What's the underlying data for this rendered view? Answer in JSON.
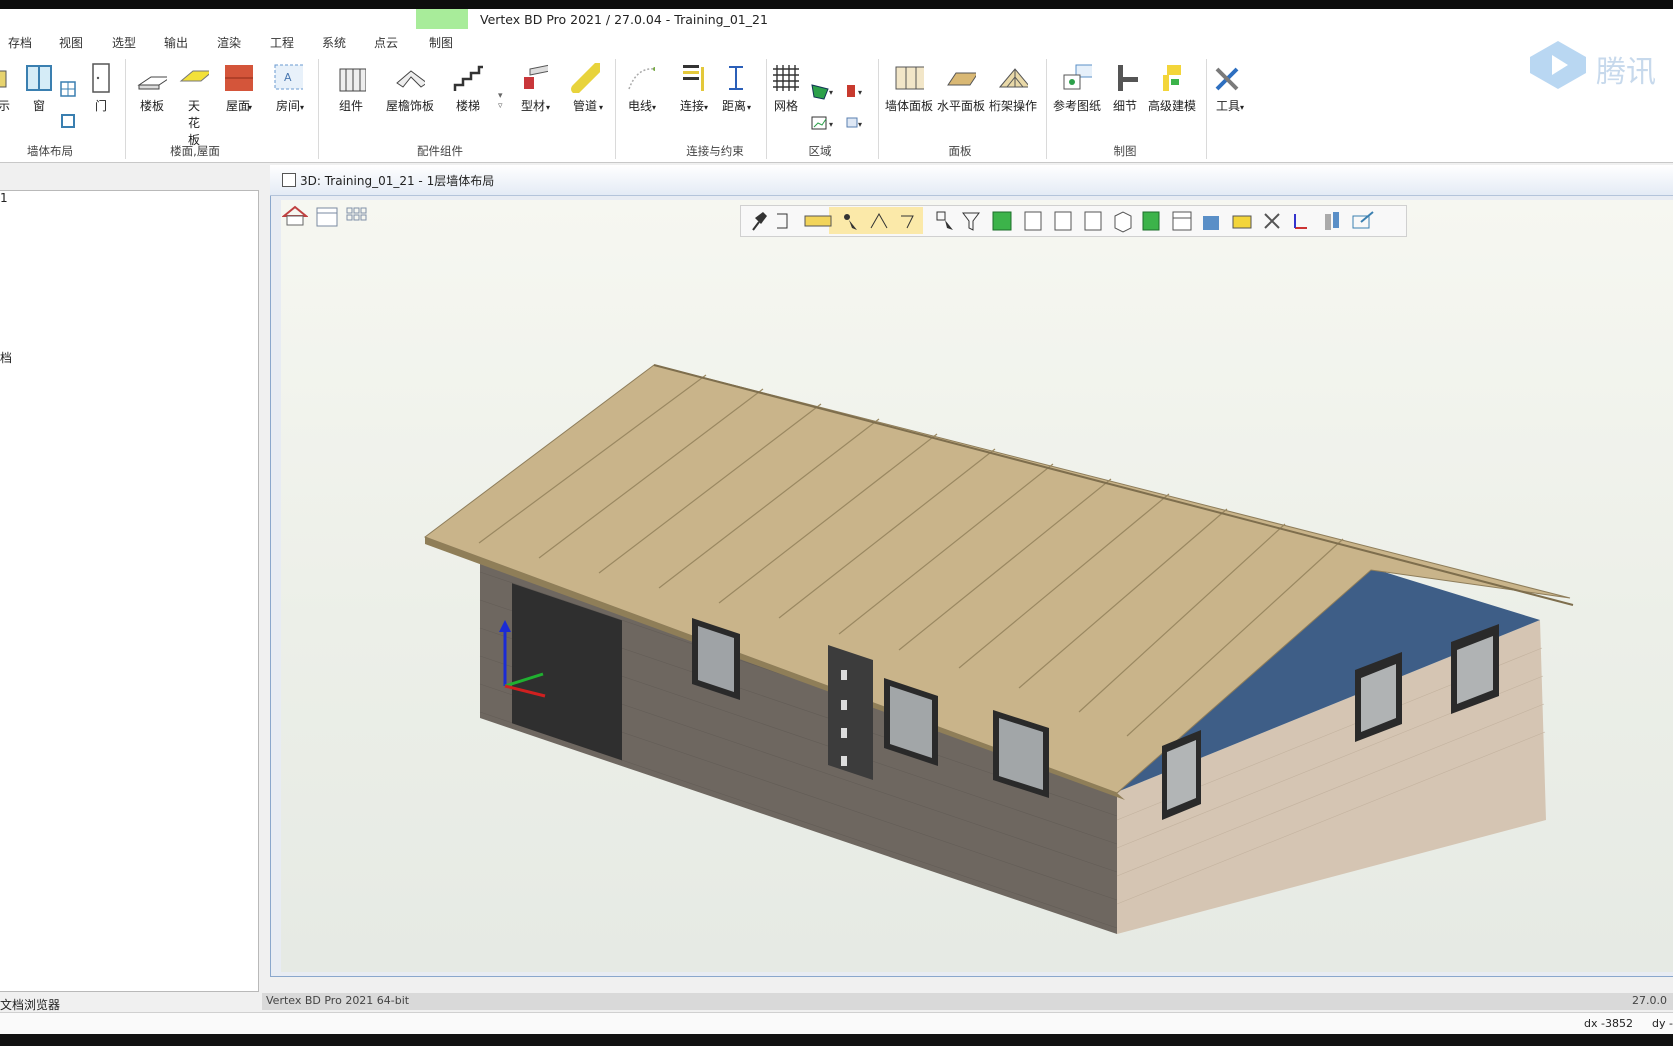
{
  "window": {
    "title": "Vertex BD Pro 2021 / 27.0.04 - Training_01_21",
    "watermark": "腾讯"
  },
  "menu": {
    "tabs": [
      "存档",
      "视图",
      "选型",
      "输出",
      "渲染",
      "工程",
      "系统",
      "点云",
      "制图"
    ]
  },
  "ribbon": {
    "buttons": [
      {
        "label": "示"
      },
      {
        "label": "窗"
      },
      {
        "label": "门"
      },
      {
        "label": "楼板"
      },
      {
        "label": "天花板"
      },
      {
        "label": "屋面"
      },
      {
        "label": "房间"
      },
      {
        "label": "组件"
      },
      {
        "label": "屋檐饰板"
      },
      {
        "label": "楼梯"
      },
      {
        "label": "型材"
      },
      {
        "label": "管道"
      },
      {
        "label": "电线"
      },
      {
        "label": "连接"
      },
      {
        "label": "距离"
      },
      {
        "label": "网格"
      },
      {
        "label": "墙体面板"
      },
      {
        "label": "水平面板"
      },
      {
        "label": "桁架操作"
      },
      {
        "label": "参考图纸"
      },
      {
        "label": "细节"
      },
      {
        "label": "高级建模"
      },
      {
        "label": "工具"
      }
    ],
    "groups": [
      "墙体布局",
      "楼面,屋面",
      "配件组件",
      "连接与约束",
      "区域",
      "面板",
      "制图"
    ]
  },
  "left_panel": {
    "items": [
      "1",
      "档"
    ],
    "footer": "文档浏览器"
  },
  "viewport": {
    "title": "3D: Training_01_21 - 1层墙体布局"
  },
  "statusbar": {
    "left": "Vertex BD Pro  2021  64-bit",
    "right": "27.0.0"
  },
  "coords": {
    "dx": "dx -3852",
    "dy": "dy -"
  },
  "colors": {
    "roof": "#c8b38a",
    "wall_dark": "#6b655f",
    "wall_light": "#d8c8b6",
    "gable_blue": "#3f5f86",
    "tab_highlight": "#a8ec9a"
  }
}
